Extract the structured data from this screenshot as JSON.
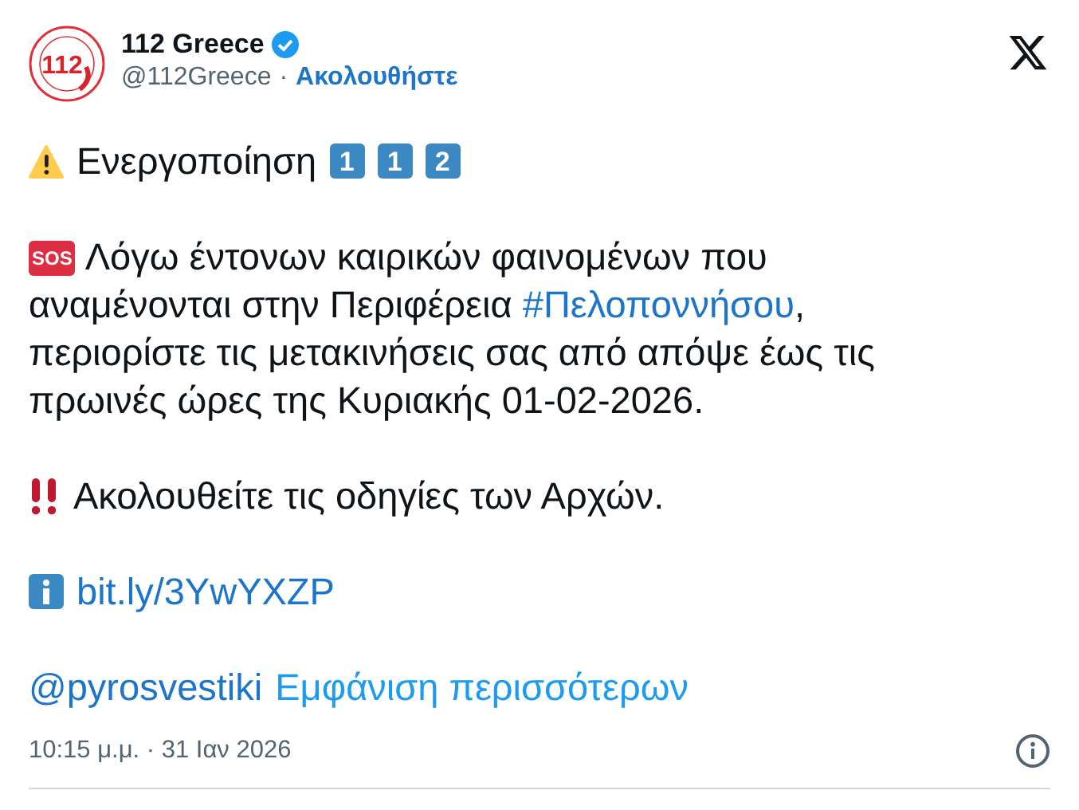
{
  "author": {
    "name": "112 Greece",
    "verified": true,
    "handle": "@112Greece",
    "separator": "·",
    "follow": "Ακολουθήστε",
    "avatar_text": "112"
  },
  "paragraphs": [
    {
      "items": [
        {
          "kind": "warning"
        },
        {
          "kind": "text",
          "text": "Ενεργοποίηση"
        },
        {
          "kind": "keycap",
          "text": "1"
        },
        {
          "kind": "keycap",
          "text": "1"
        },
        {
          "kind": "keycap",
          "text": "2"
        }
      ]
    },
    {
      "items": [
        {
          "kind": "sos",
          "text": "SOS"
        },
        {
          "kind": "text",
          "text": "Λόγω έντονων καιρικών φαινομένων που αναμένονται στην Περιφέρεια "
        },
        {
          "kind": "hashtag",
          "text": "#Πελοποννήσου"
        },
        {
          "kind": "text",
          "text": ", περιορίστε τις μετακινήσεις σας από απόψε έως τις πρωινές ώρες της Κυριακής 01-02-2026."
        }
      ]
    },
    {
      "items": [
        {
          "kind": "exclaim"
        },
        {
          "kind": "text",
          "text": "Ακολουθείτε τις οδηγίες των Αρχών."
        }
      ]
    },
    {
      "items": [
        {
          "kind": "info"
        },
        {
          "kind": "link",
          "text": "bit.ly/3YwYXZP"
        }
      ]
    },
    {
      "items": [
        {
          "kind": "mention",
          "text": "@pyrosvestiki"
        },
        {
          "kind": "more",
          "text": "Εμφάνιση περισσότερων"
        }
      ]
    }
  ],
  "timestamp": "10:15 μ.μ. · 31 Ιαν 2026"
}
